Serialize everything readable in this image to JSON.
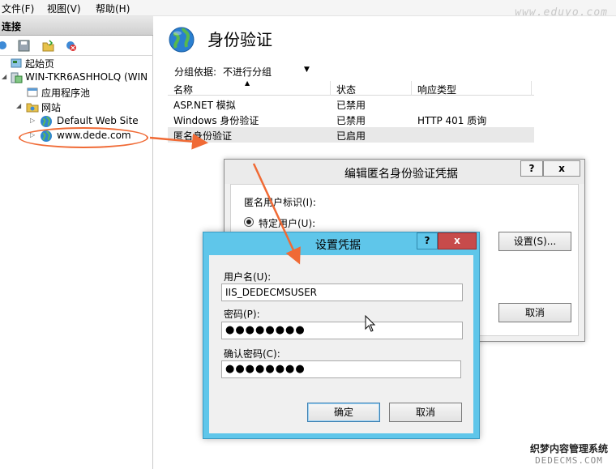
{
  "menubar": {
    "items": [
      "文件(F)",
      "视图(V)",
      "帮助(H)"
    ],
    "watermark": "www.eduyo.com"
  },
  "left_pane": {
    "header": "连接",
    "tree": [
      {
        "label": "起始页",
        "icon": "start-page-icon"
      },
      {
        "label": "WIN-TKR6ASHHOLQ (WIN",
        "icon": "server-icon"
      },
      {
        "label": "应用程序池",
        "icon": "app-pool-icon"
      },
      {
        "label": "网站",
        "icon": "folder-icon"
      },
      {
        "label": "Default Web Site",
        "icon": "globe-icon"
      },
      {
        "label": "www.dede.com",
        "icon": "globe-icon"
      }
    ]
  },
  "main": {
    "title": "身份验证",
    "group_by_label": "分组依据:",
    "group_by_value": "不进行分组",
    "columns": [
      "名称",
      "状态",
      "响应类型"
    ],
    "rows": [
      {
        "name": "ASP.NET 模拟",
        "status": "已禁用",
        "response": ""
      },
      {
        "name": "Windows 身份验证",
        "status": "已禁用",
        "response": "HTTP 401 质询"
      },
      {
        "name": "匿名身份验证",
        "status": "已启用",
        "response": ""
      }
    ]
  },
  "dialog_anon": {
    "title": "编辑匿名身份验证凭据",
    "help": "?",
    "close": "x",
    "identity_label": "匿名用户标识(I):",
    "radio_label": "特定用户(U):",
    "set_button": "设置(S)...",
    "cancel_button": "取消"
  },
  "dialog_cred": {
    "title": "设置凭据",
    "help": "?",
    "close": "x",
    "username_label": "用户名(U):",
    "username_value": "IIS_DEDECMSUSER",
    "password_label": "密码(P):",
    "password_value": "●●●●●●●●",
    "confirm_label": "确认密码(C):",
    "confirm_value": "●●●●●●●●",
    "ok_button": "确定",
    "cancel_button": "取消"
  },
  "watermark_bottom": {
    "line1": "织梦内容管理系统",
    "line2": "DEDECMS.COM"
  },
  "colors": {
    "dialog_titlebar": "#5fc6ea",
    "close_button": "#c74b4b",
    "annotation": "#f06a35"
  }
}
